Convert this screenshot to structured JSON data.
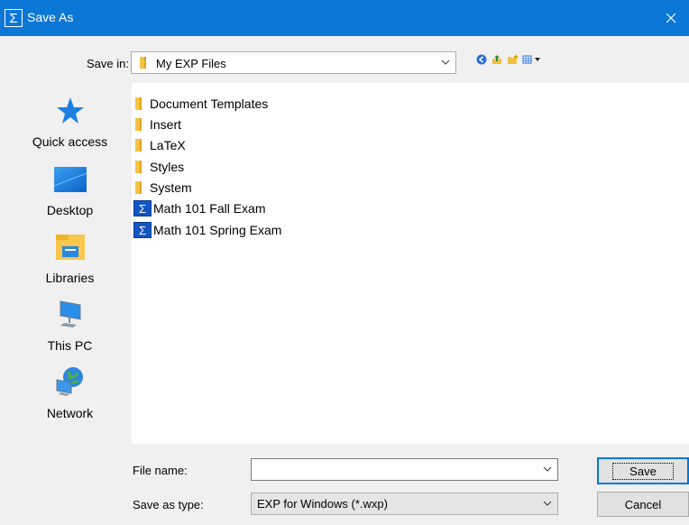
{
  "window": {
    "title": "Save As",
    "icon": "sigma-icon",
    "accent_color": "#0b77d6"
  },
  "save_in": {
    "label": "Save in:",
    "value": "My EXP Files"
  },
  "toolbar": {
    "icons": [
      "back-icon",
      "up-folder-icon",
      "new-folder-icon",
      "view-menu-icon"
    ]
  },
  "places": [
    {
      "label": "Quick access",
      "icon": "star-icon"
    },
    {
      "label": "Desktop",
      "icon": "desktop-icon"
    },
    {
      "label": "Libraries",
      "icon": "libraries-icon"
    },
    {
      "label": "This PC",
      "icon": "computer-icon"
    },
    {
      "label": "Network",
      "icon": "network-icon"
    }
  ],
  "files": [
    {
      "name": "Document Templates",
      "type": "folder"
    },
    {
      "name": "Insert",
      "type": "folder"
    },
    {
      "name": "LaTeX",
      "type": "folder"
    },
    {
      "name": "Styles",
      "type": "folder"
    },
    {
      "name": "System",
      "type": "folder"
    },
    {
      "name": "Math 101 Fall Exam",
      "type": "exp-file"
    },
    {
      "name": "Math 101 Spring Exam",
      "type": "exp-file"
    }
  ],
  "file_name": {
    "label": "File name:",
    "value": ""
  },
  "save_as_type": {
    "label": "Save as type:",
    "value": "EXP for Windows (*.wxp)"
  },
  "buttons": {
    "save": "Save",
    "cancel": "Cancel"
  }
}
